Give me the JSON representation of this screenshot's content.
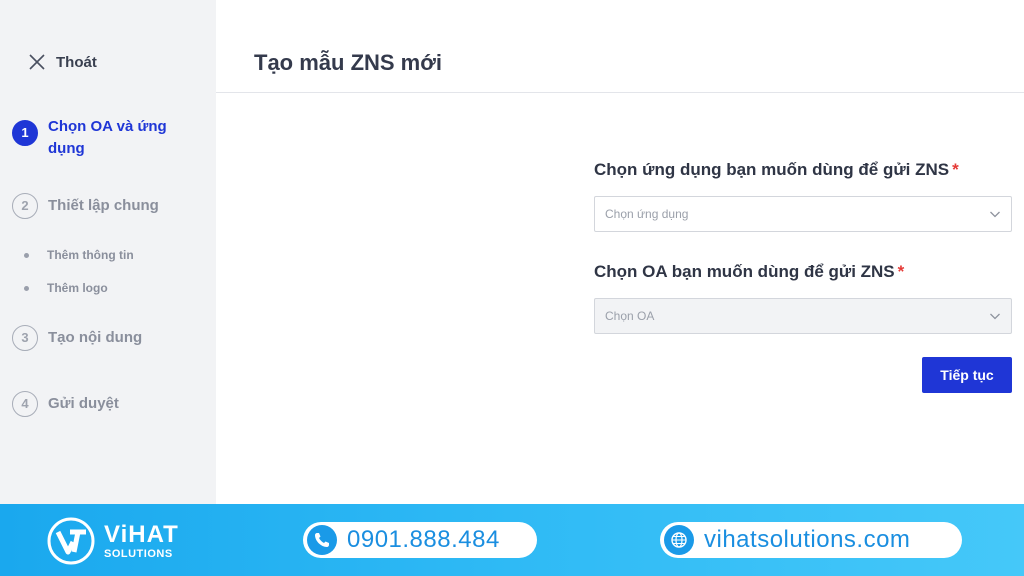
{
  "sidebar": {
    "exit_label": "Thoát",
    "steps": [
      {
        "num": "1",
        "label": "Chọn OA và ứng dụng",
        "active": true
      },
      {
        "num": "2",
        "label": "Thiết lập chung",
        "active": false
      },
      {
        "num": "3",
        "label": "Tạo nội dung",
        "active": false
      },
      {
        "num": "4",
        "label": "Gửi duyệt",
        "active": false
      }
    ],
    "substeps": [
      "Thêm thông tin",
      "Thêm logo"
    ]
  },
  "header": {
    "title": "Tạo mẫu ZNS mới"
  },
  "form": {
    "app": {
      "label": "Chọn ứng dụng bạn muốn dùng để gửi ZNS",
      "required": "*",
      "placeholder": "Chọn ứng dụng"
    },
    "oa": {
      "label": "Chọn OA bạn muốn dùng để gửi ZNS",
      "required": "*",
      "placeholder": "Chọn OA"
    },
    "next_button": "Tiếp tục"
  },
  "footer": {
    "brand_name": "ViHAT",
    "brand_sub": "SOLUTIONS",
    "phone": "0901.888.484",
    "website": "vihatsolutions.com"
  },
  "colors": {
    "accent": "#1f36d6",
    "required": "#e53935",
    "banner": "#2fbaf5"
  },
  "icons": {
    "exit": "close-icon",
    "dropdown": "chevron-down-icon",
    "phone": "phone-icon",
    "web": "globe-icon"
  }
}
